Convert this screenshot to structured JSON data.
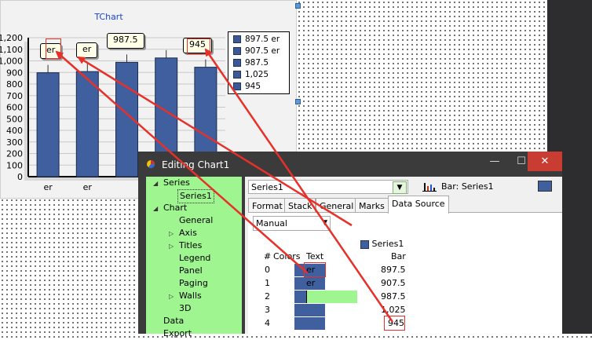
{
  "chart": {
    "title": "TChart",
    "y_ticks": [
      "1,200",
      "1,100",
      "1,000",
      "900",
      "800",
      "700",
      "600",
      "500",
      "400",
      "300",
      "200",
      "100",
      "0"
    ],
    "legend": [
      "897.5 er",
      "907.5 er",
      "987.5",
      "1,025",
      "945"
    ],
    "marks": [
      "er",
      "er",
      "987.5",
      "945"
    ],
    "x_labels": [
      "er",
      "er"
    ]
  },
  "chart_data": {
    "type": "bar",
    "title": "TChart",
    "categories": [
      "er",
      "er",
      "",
      "",
      ""
    ],
    "values": [
      897.5,
      907.5,
      987.5,
      1025,
      945
    ],
    "ylim": [
      0,
      1200
    ],
    "grid": true,
    "legend_placement": "right"
  },
  "editor": {
    "title": "Editing Chart1",
    "window_buttons": [
      "—",
      "☐",
      "✕"
    ],
    "tree": {
      "series": "Series",
      "series1": "Series1",
      "chart": "Chart",
      "general": "General",
      "axis": "Axis",
      "titles": "Titles",
      "legend": "Legend",
      "panel": "Panel",
      "paging": "Paging",
      "walls": "Walls",
      "three_d": "3D",
      "data": "Data",
      "export": "Export"
    },
    "series_select": "Series1",
    "series_type_label": "Bar: Series1",
    "tabs": [
      "Format",
      "Stack",
      "General",
      "Marks",
      "Data Source"
    ],
    "source_select": "Manual",
    "grid": {
      "series_header": "Series1",
      "headers": [
        "#",
        "Colors",
        "Text",
        "Bar"
      ],
      "rows": [
        {
          "index": "0",
          "text": "er",
          "bar": "897.5"
        },
        {
          "index": "1",
          "text": "er",
          "bar": "907.5"
        },
        {
          "index": "2",
          "text": "",
          "bar": "987.5"
        },
        {
          "index": "3",
          "text": "",
          "bar": "1,025"
        },
        {
          "index": "4",
          "text": "",
          "bar": "945"
        }
      ]
    }
  },
  "colors": {
    "bar": "#3f5f9f",
    "tree_bg": "#9ff58f",
    "annotation": "#e8302a",
    "title": "#1a44d8"
  }
}
